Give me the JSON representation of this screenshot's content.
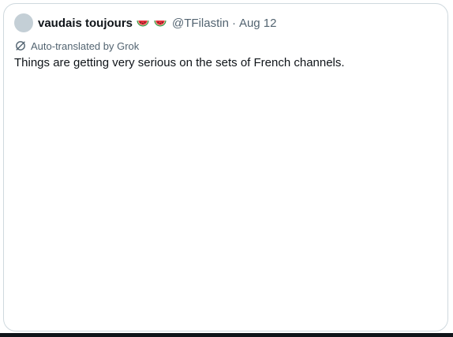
{
  "tweet": {
    "author": {
      "display_name": "vaudais toujours",
      "emojis": [
        "watermelon-emoji",
        "watermelon-emoji"
      ],
      "handle": "@TFilastin",
      "separator": "·",
      "date": "Aug 12"
    },
    "translation_label": "Auto-translated by Grok",
    "text": "Things are getting very serious on the sets of French channels."
  },
  "colors": {
    "primary_text": "#0f1419",
    "secondary_text": "#536471",
    "border": "#cfd9de",
    "avatar_placeholder": "#c4cfd6"
  }
}
